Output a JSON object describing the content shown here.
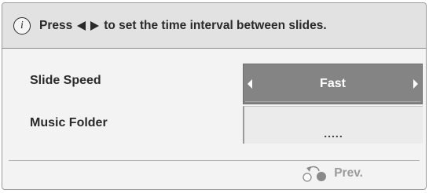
{
  "header": {
    "icon": "info-icon",
    "icon_glyph": "i",
    "text_before": "Press",
    "arrows": "left-right-arrows-icon",
    "text_after": "to set the time interval between slides."
  },
  "settings": [
    {
      "label": "Slide Speed",
      "value": "Fast",
      "selected": true
    },
    {
      "label": "Music Folder",
      "value": ".....",
      "selected": false
    }
  ],
  "footer": {
    "icon": "return-icon",
    "label": "Prev."
  }
}
